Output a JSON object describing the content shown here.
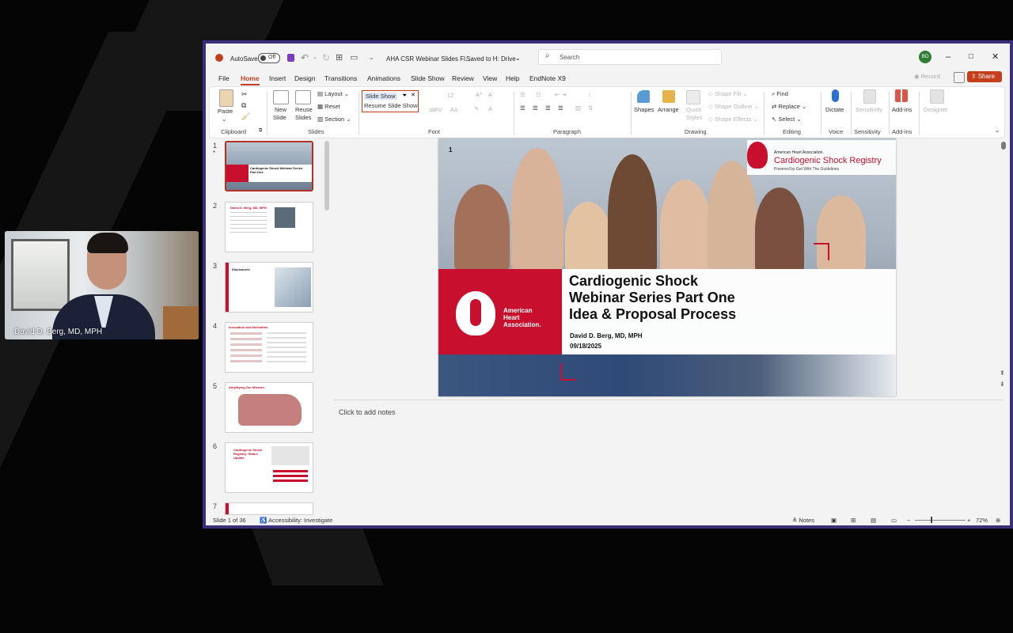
{
  "video": {
    "participant_name": "David D. Berg, MD, MPH"
  },
  "titlebar": {
    "autosave_label": "AutoSave",
    "autosave_state": "Off",
    "doc_title": "AHA CSR Webinar Slides Fl...",
    "saved_status": "Saved to H: Drive",
    "search_placeholder": "Search",
    "avatar_initials": "BD"
  },
  "menu_tabs": [
    "File",
    "Home",
    "Insert",
    "Design",
    "Transitions",
    "Animations",
    "Slide Show",
    "Review",
    "View",
    "Help",
    "EndNote X9"
  ],
  "active_tab": "Home",
  "top_right": {
    "record_label": "Record",
    "share_label": "Share"
  },
  "ribbon": {
    "clipboard": {
      "paste": "Paste",
      "group": "Clipboard"
    },
    "slides": {
      "new_slide_1": "New",
      "new_slide_2": "Slide",
      "reuse_1": "Reuse",
      "reuse_2": "Slides",
      "layout": "Layout",
      "reset": "Reset",
      "section": "Section",
      "group": "Slides"
    },
    "font": {
      "font_box": "Slide Show",
      "font_size": "12",
      "resume": "Resume Slide Show",
      "group": "Font"
    },
    "paragraph": {
      "group": "Paragraph"
    },
    "drawing": {
      "shapes": "Shapes",
      "arrange": "Arrange",
      "quick_styles_1": "Quick",
      "quick_styles_2": "Styles",
      "shape_fill": "Shape Fill",
      "shape_outline": "Shape Outline",
      "shape_effects": "Shape Effects",
      "group": "Drawing"
    },
    "editing": {
      "find": "Find",
      "replace": "Replace",
      "select": "Select",
      "group": "Editing"
    },
    "voice": {
      "dictate": "Dictate",
      "group": "Voice"
    },
    "sensitivity": {
      "label": "Sensitivity",
      "group": "Sensitivity"
    },
    "addins": {
      "label": "Add-ins",
      "group": "Add-ins"
    },
    "designer": {
      "label": "Designer"
    }
  },
  "thumbnails": [
    {
      "num": "1",
      "title": "Cardiogenic Shock Webinar Series Part One"
    },
    {
      "num": "2",
      "title": "David D. Berg, MD, MPH"
    },
    {
      "num": "3",
      "title": "Disclosures"
    },
    {
      "num": "4",
      "title": "Innovation and Motivation"
    },
    {
      "num": "5",
      "title": "Amplifying Our Mission"
    },
    {
      "num": "6",
      "title": "Cardiogenic Shock Registry: Status Update"
    },
    {
      "num": "7",
      "title": ""
    }
  ],
  "slide": {
    "number": "1",
    "title_lines": [
      "Cardiogenic Shock",
      "Webinar Series Part One",
      "Idea & Proposal Process"
    ],
    "author": "David D. Berg, MD, MPH",
    "date": "09/18/2025",
    "aha_line1": "American",
    "aha_line2": "Heart",
    "aha_line3": "Association.",
    "registry_org": "American Heart Association.",
    "registry_name": "Cardiogenic Shock Registry",
    "registry_powered": "Powered by Get With The Guidelines"
  },
  "notes_placeholder": "Click to add notes",
  "statusbar": {
    "slide_info": "Slide 1 of 36",
    "accessibility": "Accessibility: Investigate",
    "notes": "Notes",
    "zoom": "72%"
  },
  "colors": {
    "accent": "#c43e1c",
    "aha_red": "#c8102e",
    "window_border": "#3b2e7a"
  }
}
